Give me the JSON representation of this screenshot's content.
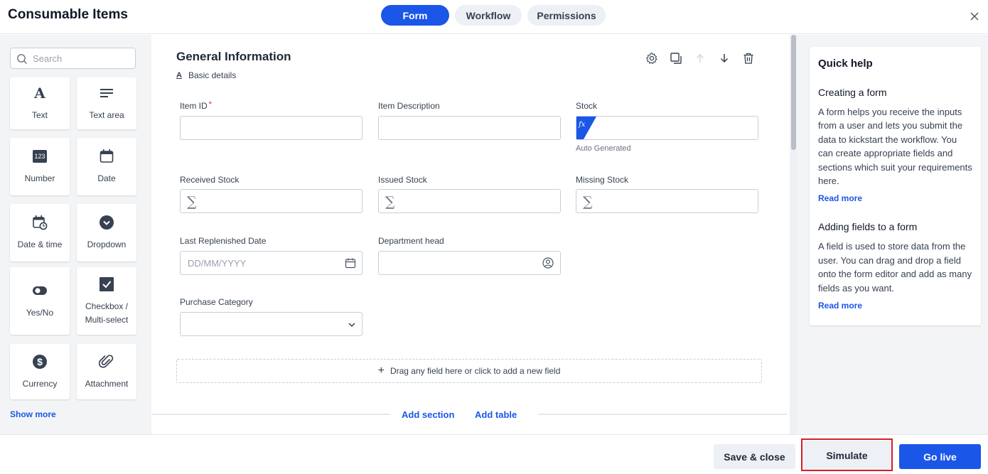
{
  "header": {
    "title": "Consumable Items",
    "tabs": [
      {
        "label": "Form",
        "active": true
      },
      {
        "label": "Workflow",
        "active": false
      },
      {
        "label": "Permissions",
        "active": false
      }
    ]
  },
  "palette": {
    "search_placeholder": "Search",
    "items": [
      {
        "label": "Text",
        "icon": "text-icon"
      },
      {
        "label": "Text area",
        "icon": "text-area-icon"
      },
      {
        "label": "Number",
        "icon": "number-icon",
        "icon_text": "123"
      },
      {
        "label": "Date",
        "icon": "calendar-icon"
      },
      {
        "label": "Date & time",
        "icon": "calendar-clock-icon"
      },
      {
        "label": "Dropdown",
        "icon": "chevron-circle-icon"
      },
      {
        "label": "Yes/No",
        "icon": "toggle-icon"
      },
      {
        "label": "Checkbox / Multi-select",
        "icon": "checkbox-icon"
      },
      {
        "label": "Currency",
        "icon": "dollar-icon"
      },
      {
        "label": "Attachment",
        "icon": "paperclip-icon"
      }
    ],
    "show_more": "Show more"
  },
  "section": {
    "title": "General Information",
    "subtitle": "Basic details",
    "subtitle_icon": "A",
    "fields": {
      "item_id": {
        "label": "Item ID",
        "required_mark": "*"
      },
      "item_description": {
        "label": "Item Description"
      },
      "stock": {
        "label": "Stock",
        "badge": "fx",
        "hint": "Auto Generated"
      },
      "received_stock": {
        "label": "Received Stock",
        "symbol": "∑"
      },
      "issued_stock": {
        "label": "Issued Stock",
        "symbol": "∑"
      },
      "missing_stock": {
        "label": "Missing Stock",
        "symbol": "∑"
      },
      "last_replenished_date": {
        "label": "Last Replenished Date",
        "placeholder": "DD/MM/YYYY"
      },
      "department_head": {
        "label": "Department head"
      },
      "purchase_category": {
        "label": "Purchase Category"
      }
    },
    "dropzone_text": "Drag any field here or click to add a new field",
    "dropzone_plus": "+",
    "add_section": "Add section",
    "add_table": "Add table"
  },
  "help": {
    "title": "Quick help",
    "topics": [
      {
        "heading": "Creating a form",
        "body": "A form helps you receive the inputs from a user and lets you submit the data to kickstart the workflow. You can create appropriate fields and sections which suit your requirements here.",
        "link": "Read more"
      },
      {
        "heading": "Adding fields to a form",
        "body": "A field is used to store data from the user. You can drag and drop a field onto the form editor and add as many fields as you want.",
        "link": "Read more"
      }
    ]
  },
  "footer": {
    "save_close": "Save & close",
    "simulate": "Simulate",
    "go_live": "Go live"
  },
  "colors": {
    "accent": "#1a56e8",
    "highlight_frame": "#d61f26"
  }
}
